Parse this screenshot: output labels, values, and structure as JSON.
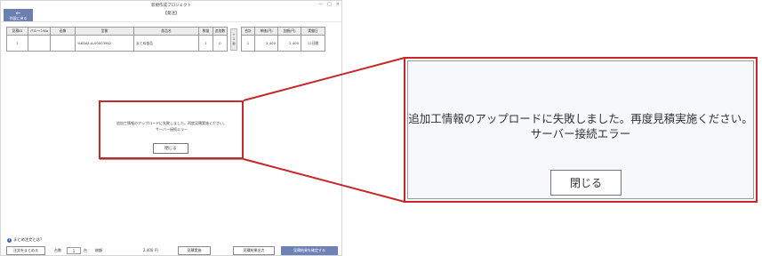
{
  "window": {
    "title": "新規作成プロジェクト",
    "controls": {
      "minimize": "—",
      "maximize": "□",
      "close": "×"
    }
  },
  "toolbar": {
    "back_arrow": "←",
    "back_label": "作図に戻る",
    "heading": "【発注】"
  },
  "table": {
    "headers": [
      "見積ID",
      "バルーンNo",
      "画像",
      "型番",
      "部品名",
      "数量",
      "追加数"
    ],
    "row": [
      "1",
      "",
      "",
      "%KDAF-A-00003992",
      "まとめ部品",
      "1",
      "0"
    ],
    "right_headers": [
      "合計",
      "単価(円)",
      "金額(円)",
      "実働日"
    ],
    "right_row": [
      "1",
      "2,400",
      "2,400",
      "12日間"
    ],
    "mid_button": [
      "+",
      "1",
      "台"
    ]
  },
  "dialog": {
    "message_line1": "追加工情報のアップロードに失敗しました。再度見積実施ください。",
    "message_line2": "サーバー接続エラー",
    "close_label": "閉じる"
  },
  "footer": {
    "help_icon": "i",
    "help_text": "まとめ注文とは？",
    "bundle_button": "注文をまとめる",
    "units_label": "台数",
    "units_value": "1",
    "units_suffix": "台",
    "total_label": "総額",
    "total_value": "2,400 円",
    "estimate_button": "見積実施",
    "output_button": "見積結果出力",
    "confirm_button": "見積結果を確定する"
  },
  "colors": {
    "highlight": "#c62828",
    "primary_button": "#6e82b8",
    "back_button": "#6c7fb0"
  }
}
